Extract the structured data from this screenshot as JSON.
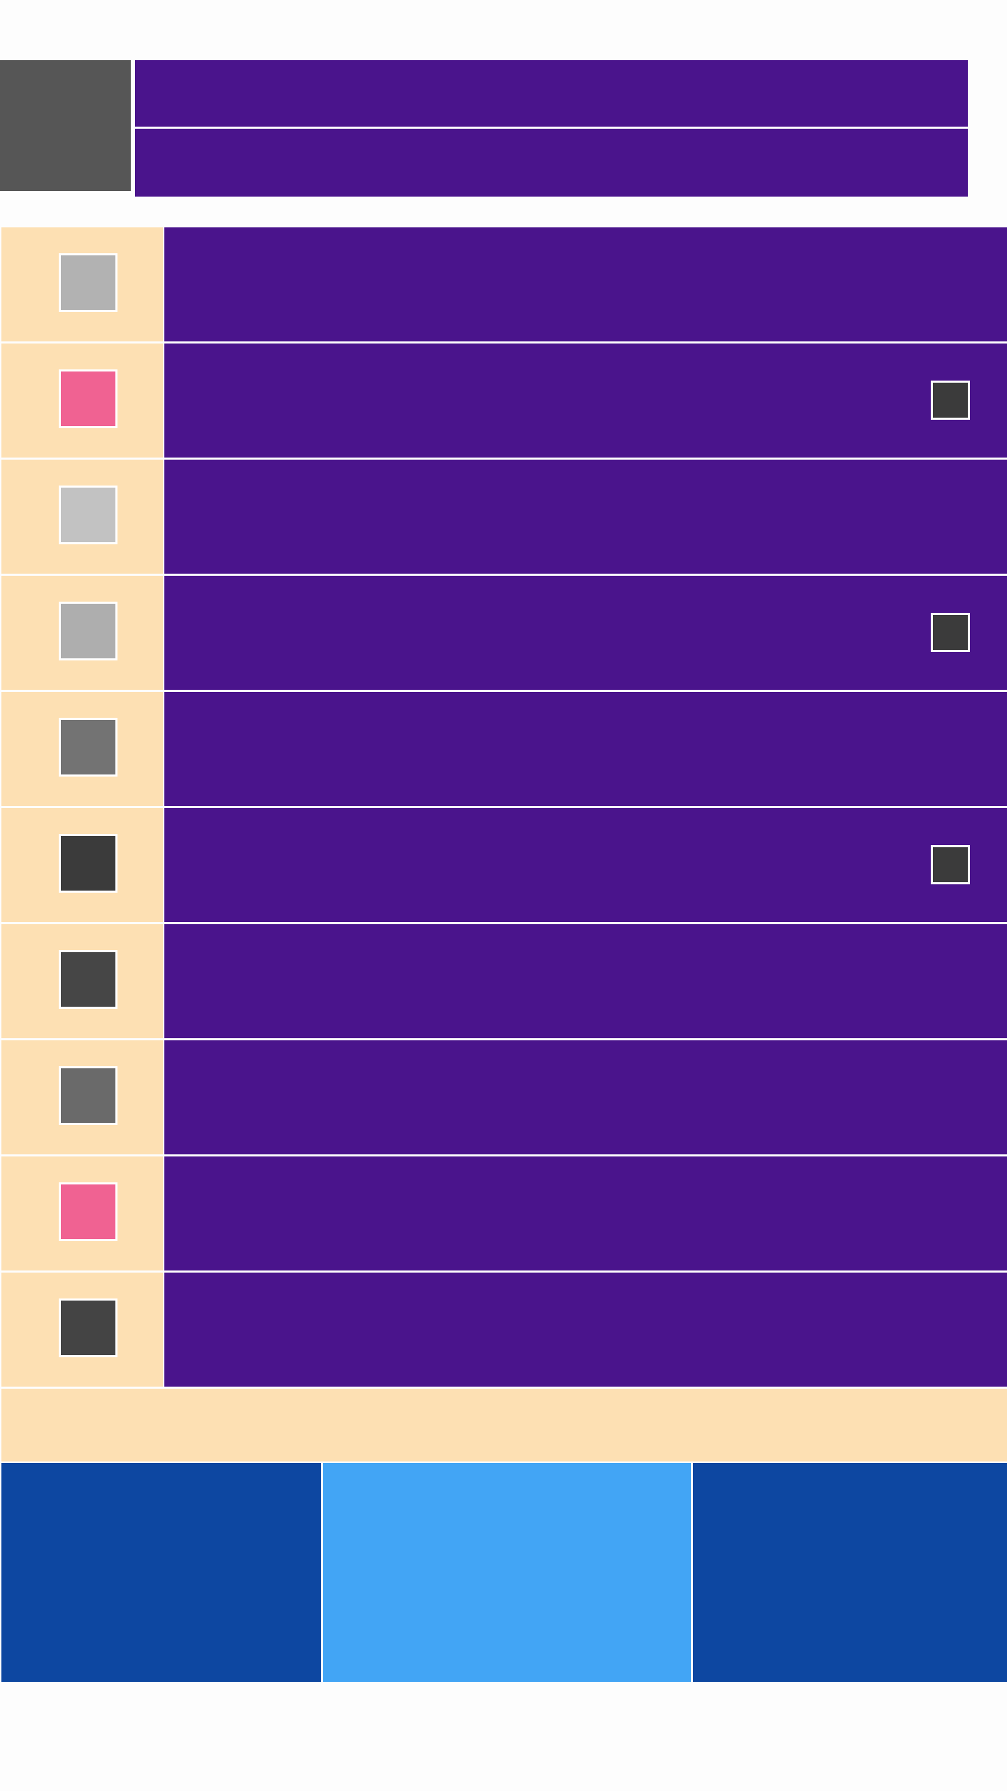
{
  "colors": {
    "page_bg": "#fdfdfd",
    "header_bg": "#4a148c",
    "avatar_bg": "#565656",
    "list_icon_cell_bg": "#fde0b3",
    "list_body_bg": "#4a148c",
    "checkbox_bg": "#3b3b3b",
    "footer_band_bg": "#fde0b3",
    "tab_bg": "#0d47a1",
    "tab_selected_bg": "#42a5f5"
  },
  "header": {
    "avatar_icon": "avatar-placeholder",
    "title": "",
    "subtitle": ""
  },
  "list": {
    "items": [
      {
        "swatch_color": "#b2b2b2",
        "label": "",
        "has_checkbox": false
      },
      {
        "swatch_color": "#f06292",
        "label": "",
        "has_checkbox": true
      },
      {
        "swatch_color": "#c2c2c2",
        "label": "",
        "has_checkbox": false
      },
      {
        "swatch_color": "#aeaeae",
        "label": "",
        "has_checkbox": true
      },
      {
        "swatch_color": "#737373",
        "label": "",
        "has_checkbox": false
      },
      {
        "swatch_color": "#3b3b3b",
        "label": "",
        "has_checkbox": true
      },
      {
        "swatch_color": "#464646",
        "label": "",
        "has_checkbox": false
      },
      {
        "swatch_color": "#6a6a6a",
        "label": "",
        "has_checkbox": false
      },
      {
        "swatch_color": "#f06292",
        "label": "",
        "has_checkbox": false
      },
      {
        "swatch_color": "#444444",
        "label": "",
        "has_checkbox": false
      }
    ]
  },
  "footer": {
    "text": ""
  },
  "tabs": {
    "selected_index": 1,
    "items": [
      {
        "label": ""
      },
      {
        "label": ""
      },
      {
        "label": ""
      }
    ]
  }
}
